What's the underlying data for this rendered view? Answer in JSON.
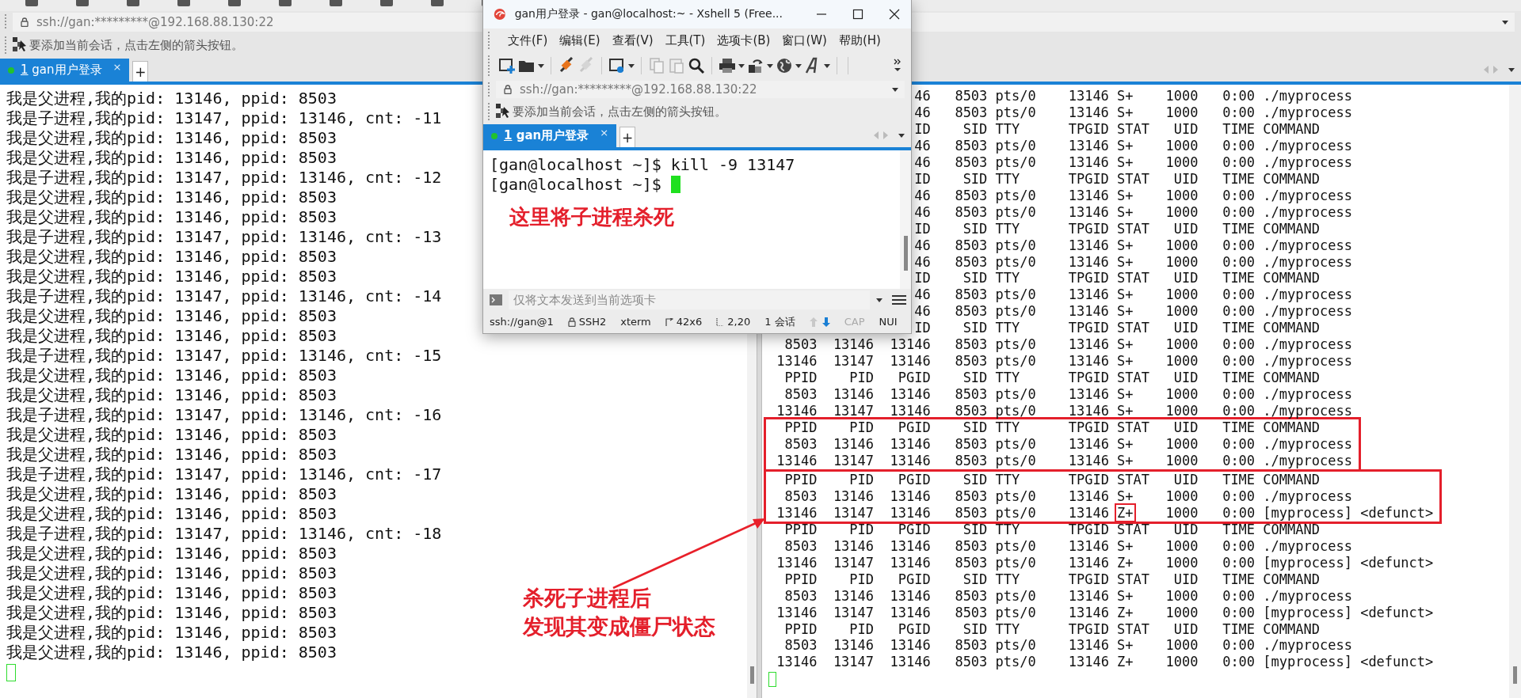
{
  "main_window": {
    "address_bar": {
      "text": "ssh://gan:*********@192.168.88.130:22"
    },
    "info_bar": {
      "text": "要添加当前会话，点击左侧的箭头按钮。"
    },
    "tabs": [
      {
        "number": "1",
        "label": "gan用户登录",
        "selected": true,
        "connected": true,
        "close": "×"
      }
    ],
    "new_tab": "+",
    "left_terminal": {
      "cursor_focused": false,
      "lines": [
        "我是父进程,我的pid: 13146, ppid: 8503",
        "我是子进程,我的pid: 13147, ppid: 13146, cnt: -11",
        "我是父进程,我的pid: 13146, ppid: 8503",
        "我是父进程,我的pid: 13146, ppid: 8503",
        "我是子进程,我的pid: 13147, ppid: 13146, cnt: -12",
        "我是父进程,我的pid: 13146, ppid: 8503",
        "我是父进程,我的pid: 13146, ppid: 8503",
        "我是子进程,我的pid: 13147, ppid: 13146, cnt: -13",
        "我是父进程,我的pid: 13146, ppid: 8503",
        "我是父进程,我的pid: 13146, ppid: 8503",
        "我是子进程,我的pid: 13147, ppid: 13146, cnt: -14",
        "我是父进程,我的pid: 13146, ppid: 8503",
        "我是父进程,我的pid: 13146, ppid: 8503",
        "我是子进程,我的pid: 13147, ppid: 13146, cnt: -15",
        "我是父进程,我的pid: 13146, ppid: 8503",
        "我是父进程,我的pid: 13146, ppid: 8503",
        "我是子进程,我的pid: 13147, ppid: 13146, cnt: -16",
        "我是父进程,我的pid: 13146, ppid: 8503",
        "我是父进程,我的pid: 13146, ppid: 8503",
        "我是子进程,我的pid: 13147, ppid: 13146, cnt: -17",
        "我是父进程,我的pid: 13146, ppid: 8503",
        "我是父进程,我的pid: 13146, ppid: 8503",
        "我是子进程,我的pid: 13147, ppid: 13146, cnt: -18",
        "我是父进程,我的pid: 13146, ppid: 8503",
        "我是父进程,我的pid: 13146, ppid: 8503",
        "我是父进程,我的pid: 13146, ppid: 8503",
        "我是父进程,我的pid: 13146, ppid: 8503",
        "我是父进程,我的pid: 13146, ppid: 8503",
        "我是父进程,我的pid: 13146, ppid: 8503"
      ]
    },
    "right_terminal": {
      "cursor_focused": false,
      "blocks": [
        {
          "framed": false,
          "rows": [
            {
              "kind": "clipped",
              "text": "46   8503 pts/0    13146 S+    1000   0:00 ./myprocess"
            },
            {
              "kind": "clipped",
              "text": "46   8503 pts/0    13146 S+    1000   0:00 ./myprocess"
            },
            {
              "kind": "clipped",
              "text": "ID    SID TTY      TPGID STAT   UID   TIME COMMAND"
            },
            {
              "kind": "clipped",
              "text": "46   8503 pts/0    13146 S+    1000   0:00 ./myprocess"
            },
            {
              "kind": "clipped",
              "text": "46   8503 pts/0    13146 S+    1000   0:00 ./myprocess"
            },
            {
              "kind": "clipped",
              "text": "ID    SID TTY      TPGID STAT   UID   TIME COMMAND"
            },
            {
              "kind": "clipped",
              "text": "46   8503 pts/0    13146 S+    1000   0:00 ./myprocess"
            },
            {
              "kind": "clipped",
              "text": "46   8503 pts/0    13146 S+    1000   0:00 ./myprocess"
            },
            {
              "kind": "clipped",
              "text": "ID    SID TTY      TPGID STAT   UID   TIME COMMAND"
            },
            {
              "kind": "clipped",
              "text": "46   8503 pts/0    13146 S+    1000   0:00 ./myprocess"
            },
            {
              "kind": "clipped",
              "text": "46   8503 pts/0    13146 S+    1000   0:00 ./myprocess"
            },
            {
              "kind": "clipped",
              "text": "ID    SID TTY      TPGID STAT   UID   TIME COMMAND"
            },
            {
              "kind": "clipped",
              "text": "46   8503 pts/0    13146 S+    1000   0:00 ./myprocess"
            },
            {
              "kind": "clipped",
              "text": "46   8503 pts/0    13146 S+    1000   0:00 ./myprocess"
            },
            {
              "kind": "clipped",
              "text": "ID    SID TTY      TPGID STAT   UID   TIME COMMAND"
            },
            {
              "kind": "parent",
              "text": "8503  13146  13146   8503 pts/0    13146 S+    1000   0:00 ./myprocess"
            },
            {
              "kind": "child",
              "text": "13146  13147  13146   8503 pts/0    13146 S+    1000   0:00 ./myprocess"
            },
            {
              "kind": "header",
              "text": "PPID    PID   PGID    SID TTY      TPGID STAT   UID   TIME COMMAND"
            },
            {
              "kind": "parent",
              "text": "8503  13146  13146   8503 pts/0    13146 S+    1000   0:00 ./myprocess"
            },
            {
              "kind": "child",
              "text": "13146  13147  13146   8503 pts/0    13146 S+    1000   0:00 ./myprocess"
            }
          ]
        },
        {
          "framed": true,
          "rows": [
            {
              "kind": "header",
              "text": "PPID    PID   PGID    SID TTY      TPGID STAT   UID   TIME COMMAND"
            },
            {
              "kind": "parent",
              "text": "8503  13146  13146   8503 pts/0    13146 S+    1000   0:00 ./myprocess"
            },
            {
              "kind": "child",
              "text": "13146  13147  13146   8503 pts/0    13146 S+    1000   0:00 ./myprocess"
            }
          ]
        },
        {
          "framed": true,
          "rows": [
            {
              "kind": "header",
              "text": "PPID    PID   PGID    SID TTY      TPGID STAT   UID   TIME COMMAND"
            },
            {
              "kind": "parent",
              "text": "8503  13146  13146   8503 pts/0    13146 S+    1000   0:00 ./myprocess"
            },
            {
              "kind": "child",
              "segments": [
                {
                  "text": "13146  13147  13146   8503 pts/0    13146",
                  "framed": false
                },
                {
                  "text": "Z+",
                  "framed": true
                },
                {
                  "text": "1000   0:00 [myprocess] <defunct>",
                  "framed": false
                }
              ]
            }
          ]
        },
        {
          "framed": false,
          "rows": [
            {
              "kind": "header",
              "text": "PPID    PID   PGID    SID TTY      TPGID STAT   UID   TIME COMMAND"
            },
            {
              "kind": "parent",
              "text": "8503  13146  13146   8503 pts/0    13146 S+    1000   0:00 ./myprocess"
            },
            {
              "kind": "child",
              "text": "13146  13147  13146   8503 pts/0    13146 Z+    1000   0:00 [myprocess] <defunct>"
            },
            {
              "kind": "header",
              "text": "PPID    PID   PGID    SID TTY      TPGID STAT   UID   TIME COMMAND"
            },
            {
              "kind": "parent",
              "text": "8503  13146  13146   8503 pts/0    13146 S+    1000   0:00 ./myprocess"
            },
            {
              "kind": "child",
              "text": "13146  13147  13146   8503 pts/0    13146 Z+    1000   0:00 [myprocess] <defunct>"
            },
            {
              "kind": "header",
              "text": "PPID    PID   PGID    SID TTY      TPGID STAT   UID   TIME COMMAND"
            },
            {
              "kind": "parent",
              "text": "8503  13146  13146   8503 pts/0    13146 S+    1000   0:00 ./myprocess"
            },
            {
              "kind": "child",
              "text": "13146  13147  13146   8503 pts/0    13146 Z+    1000   0:00 [myprocess] <defunct>"
            }
          ]
        }
      ]
    },
    "annotation": {
      "lines": [
        "杀死子进程后",
        "发现其变成僵尸状态"
      ]
    }
  },
  "popup_window": {
    "title": "gan用户登录 - gan@localhost:~ - Xshell 5 (Free...",
    "menu": [
      "文件(F)",
      "编辑(E)",
      "查看(V)",
      "工具(T)",
      "选项卡(B)",
      "窗口(W)",
      "帮助(H)"
    ],
    "toolbar": [
      {
        "kind": "new",
        "disabled": false,
        "dropdown": false
      },
      {
        "kind": "open",
        "disabled": false,
        "dropdown": true
      },
      {
        "kind": "connect",
        "disabled": false,
        "dropdown": false
      },
      {
        "kind": "disconnect",
        "disabled": true,
        "dropdown": false
      },
      {
        "kind": "properties",
        "disabled": false,
        "dropdown": true
      },
      {
        "kind": "copy",
        "disabled": true,
        "dropdown": false
      },
      {
        "kind": "paste",
        "disabled": true,
        "dropdown": false
      },
      {
        "kind": "find",
        "disabled": false,
        "dropdown": false
      },
      {
        "kind": "print",
        "disabled": false,
        "dropdown": true
      },
      {
        "kind": "transfer",
        "disabled": false,
        "dropdown": true
      },
      {
        "kind": "globe",
        "disabled": false,
        "dropdown": true
      },
      {
        "kind": "font",
        "disabled": false,
        "dropdown": true
      }
    ],
    "address_bar": {
      "text": "ssh://gan:*********@192.168.88.130:22"
    },
    "info_bar": {
      "text": "要添加当前会话，点击左侧的箭头按钮。"
    },
    "tabs": [
      {
        "number": "1",
        "label": "gan用户登录",
        "selected": true,
        "connected": true,
        "close": "×"
      }
    ],
    "new_tab": "+",
    "terminal": {
      "cursor_focused": true,
      "lines": [
        "[gan@localhost ~]$ kill -9 13147",
        "[gan@localhost ~]$ "
      ],
      "annotation": "这里将子进程杀死"
    },
    "compose": {
      "placeholder": "仅将文本发送到当前选项卡"
    },
    "status_bar": [
      {
        "kind": "plain",
        "text": "ssh://gan@1"
      },
      {
        "kind": "lock",
        "text": "SSH2"
      },
      {
        "kind": "plain",
        "text": "xterm"
      },
      {
        "kind": "size",
        "text": "42x6"
      },
      {
        "kind": "position",
        "text": "2,20"
      },
      {
        "kind": "plain",
        "text": "1 会话"
      },
      {
        "kind": "arrows"
      },
      {
        "kind": "indicator",
        "text": "CAP",
        "on": false
      },
      {
        "kind": "indicator",
        "text": "NUI",
        "on": true
      }
    ]
  }
}
